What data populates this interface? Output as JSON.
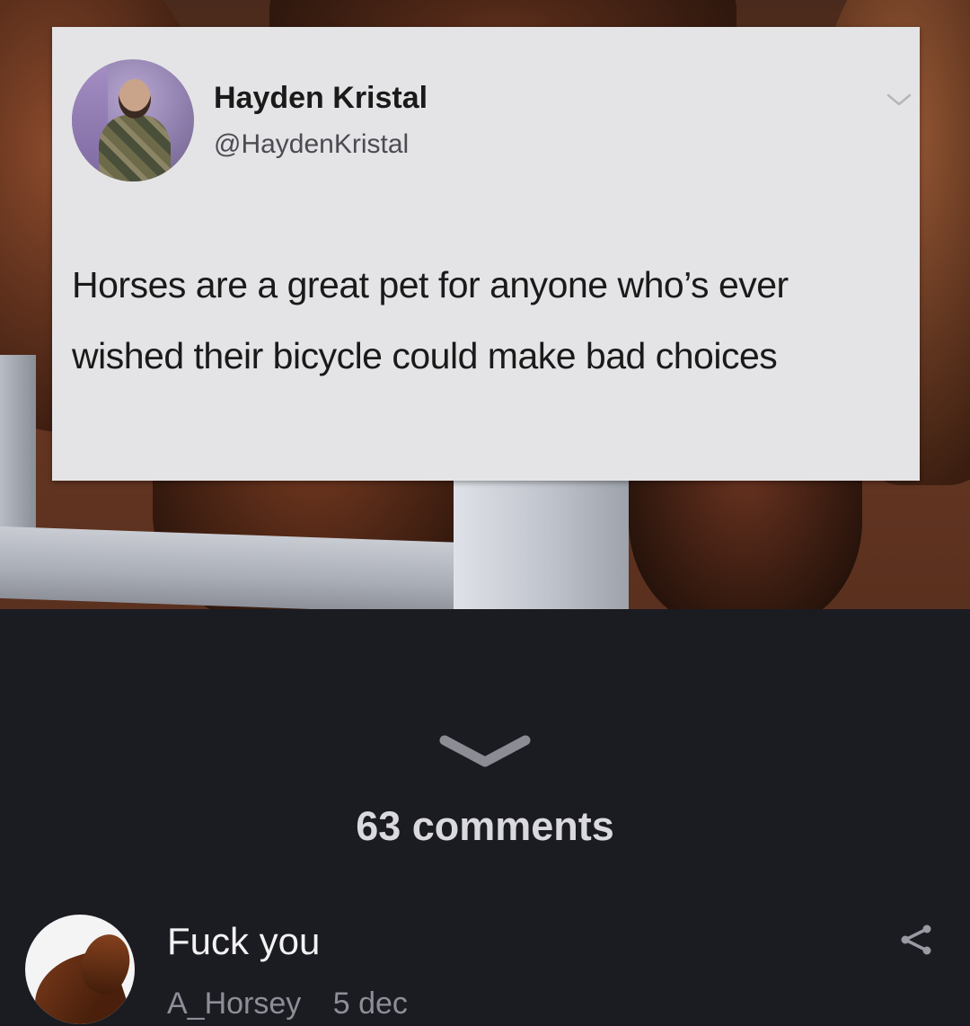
{
  "post": {
    "author_name": "Hayden Kristal",
    "author_handle": "@HaydenKristal",
    "text": "Horses are a great pet for anyone who’s ever wished their bicycle could make bad choices"
  },
  "comments_section": {
    "count_label": "63 comments"
  },
  "comment": {
    "text": "Fuck you",
    "username": "A_Horsey",
    "date": "5 dec"
  },
  "icons": {
    "tweet_menu": "chevron-down-icon",
    "expand": "chevron-down-icon",
    "share": "share-icon"
  },
  "colors": {
    "background": "#1b1b22",
    "tweet_card": "#e4e4e6",
    "comment_meta": "#8e8e98"
  }
}
